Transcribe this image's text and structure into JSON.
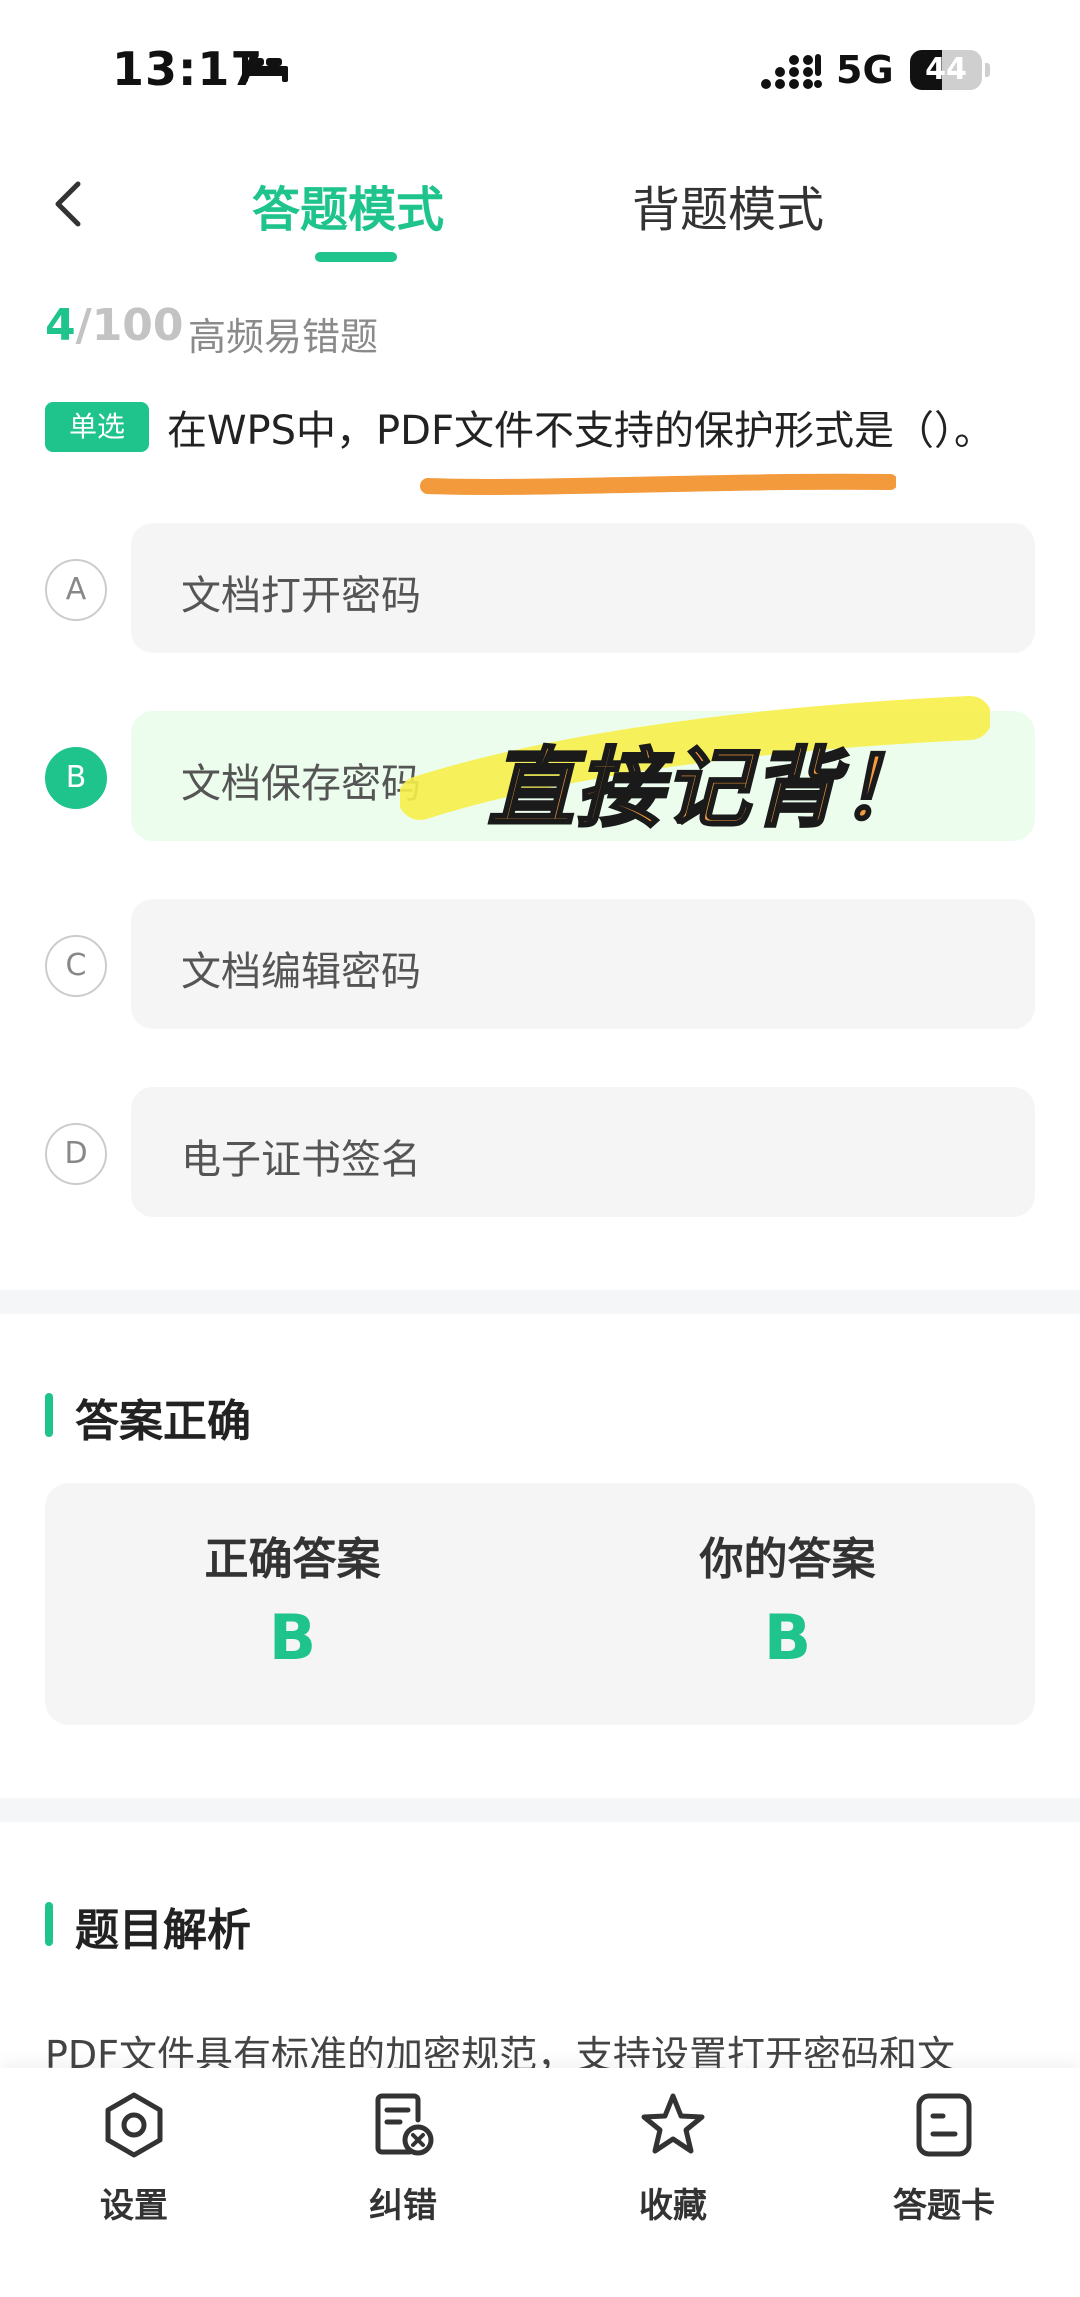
{
  "status_bar": {
    "time": "13:17",
    "network": "5G",
    "battery": "44",
    "battery_level": 0.44
  },
  "header": {
    "tabs": [
      {
        "label": "答题模式",
        "active": true
      },
      {
        "label": "背题模式",
        "active": false
      }
    ]
  },
  "progress": {
    "current": "4",
    "total": "/100",
    "category": "高频易错题"
  },
  "question": {
    "type_badge": "单选",
    "text": "在WPS中，PDF文件不支持的保护形式是（）。"
  },
  "options": [
    {
      "letter": "A",
      "text": "文档打开密码"
    },
    {
      "letter": "B",
      "text": "文档保存密码",
      "selected": true
    },
    {
      "letter": "C",
      "text": "文档编辑密码"
    },
    {
      "letter": "D",
      "text": "电子证书签名"
    }
  ],
  "overlay_text": "直接记背！",
  "result": {
    "title": "答案正确",
    "correct_label": "正确答案",
    "correct_value": "B",
    "yours_label": "你的答案",
    "yours_value": "B"
  },
  "analysis": {
    "title": "题目解析",
    "text": "PDF文件具有标准的加密规范，支持设置打开密码和文"
  },
  "bottom_nav": [
    {
      "label": "设置",
      "icon": "settings-icon"
    },
    {
      "label": "纠错",
      "icon": "report-error-icon"
    },
    {
      "label": "收藏",
      "icon": "star-icon"
    },
    {
      "label": "答题卡",
      "icon": "answer-card-icon"
    }
  ],
  "colors": {
    "accent": "#1ec48b",
    "highlight_orange": "#f29a3c",
    "highlight_yellow": "#f7f04a"
  }
}
